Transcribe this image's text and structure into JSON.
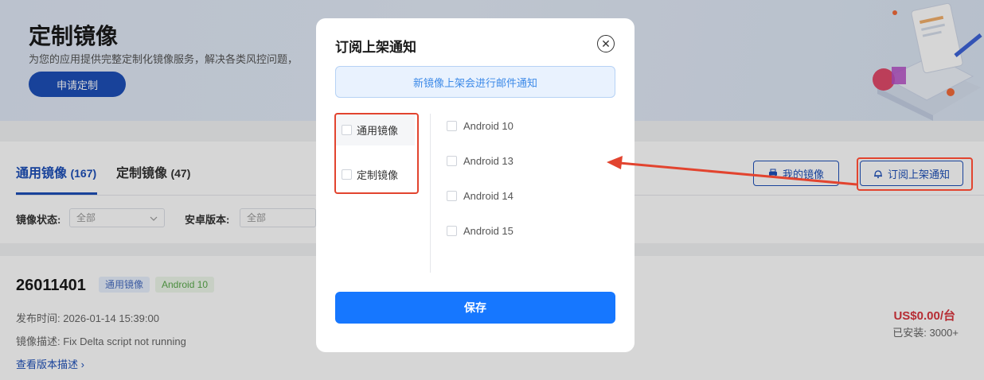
{
  "hero": {
    "title": "定制镜像",
    "description": "为您的应用提供完整定制化镜像服务，解决各类风控问题，",
    "apply_button": "申请定制"
  },
  "tabs": [
    {
      "label": "通用镜像",
      "count": "(167)",
      "active": true
    },
    {
      "label": "定制镜像",
      "count": "(47)",
      "active": false
    }
  ],
  "toolbar": {
    "my_images_label": "我的镜像",
    "subscribe_label": "订阅上架通知"
  },
  "filters": {
    "status_label": "镜像状态:",
    "status_value": "全部",
    "android_label": "安卓版本:",
    "android_value": "全部"
  },
  "card": {
    "id": "26011401",
    "tag_type": "通用镜像",
    "tag_android": "Android 10",
    "publish_time": "发布时间: 2026-01-14 15:39:00",
    "description": "镜像描述: Fix Delta script not running",
    "view_notes": "查看版本描述",
    "price": "US$0.00/台",
    "installs": "已安装: 3000+"
  },
  "modal": {
    "title": "订阅上架通知",
    "notice": "新镜像上架会进行邮件通知",
    "image_types": [
      "通用镜像",
      "定制镜像"
    ],
    "android_versions": [
      "Android 10",
      "Android 13",
      "Android 14",
      "Android 15"
    ],
    "save_label": "保存"
  },
  "colors": {
    "primary": "#1d4fb8",
    "save_button": "#1677ff",
    "annotation": "#e2442f",
    "price": "#d9363e"
  }
}
